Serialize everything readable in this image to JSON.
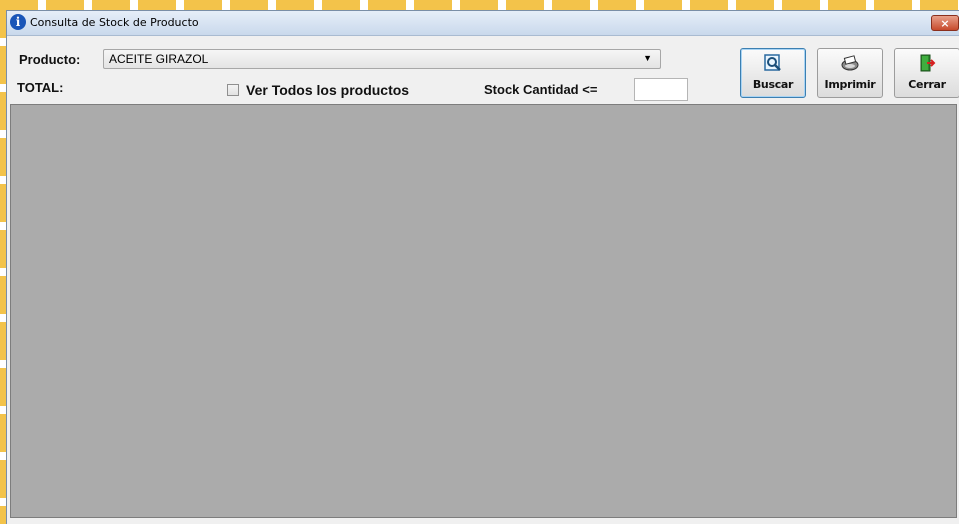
{
  "window": {
    "title": "Consulta de Stock de Producto",
    "close_label": "×"
  },
  "form": {
    "producto_label": "Producto:",
    "producto_value": "ACEITE GIRAZOL",
    "total_label": "TOTAL:",
    "ver_todos_label": "Ver Todos los productos",
    "ver_todos_checked": false,
    "stock_cantidad_label": "Stock Cantidad <=",
    "stock_cantidad_value": ""
  },
  "toolbar": {
    "buscar_label": "Buscar",
    "imprimir_label": "Imprimir",
    "cerrar_label": "Cerrar"
  },
  "icons": {
    "title": "info-icon",
    "buscar": "magnifier-icon",
    "imprimir": "printer-icon",
    "cerrar": "exit-door-icon"
  },
  "colors": {
    "grid_background": "#ababab",
    "desktop_dash": "#f3c34a"
  }
}
